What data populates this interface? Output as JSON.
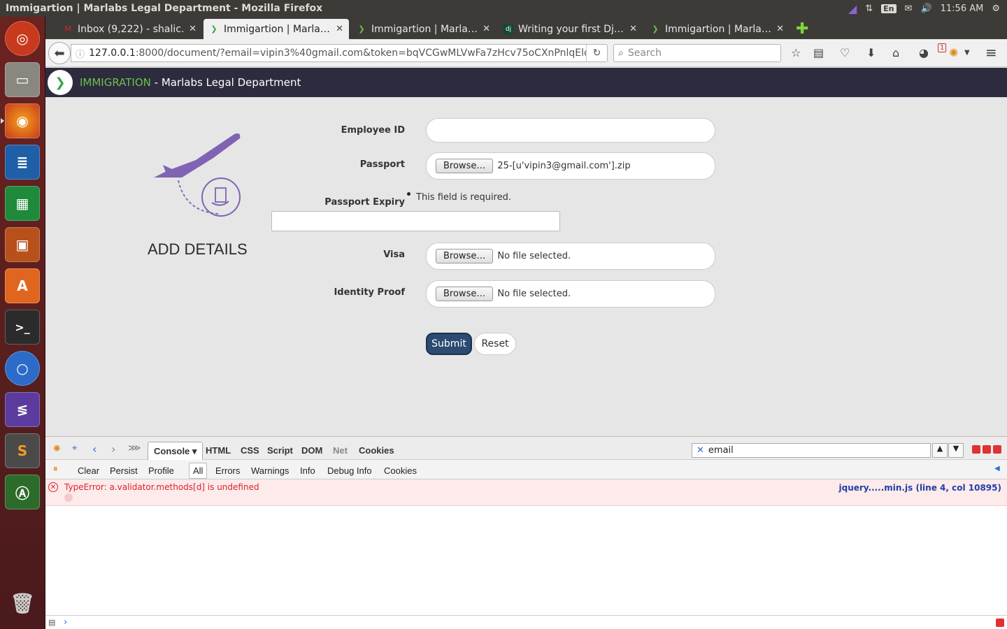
{
  "window": {
    "title": "Immigartion | Marlabs Legal Department - Mozilla Firefox",
    "clock": "11:56 AM",
    "keyboard": "En"
  },
  "tabs": [
    {
      "label": "Inbox (9,222) - shalic…",
      "icon": "gmail-icon"
    },
    {
      "label": "Immigartion | Marla…",
      "icon": "app-favicon-icon"
    },
    {
      "label": "Immigartion | Marla…",
      "icon": "app-favicon-icon"
    },
    {
      "label": "Writing your first Dj…",
      "icon": "django-icon"
    },
    {
      "label": "Immigartion | Marla…",
      "icon": "app-favicon-icon"
    }
  ],
  "nav": {
    "url_host": "127.0.0.1",
    "url_rest": ":8000/document/?email=vipin3%40gmail.com&token=bqVCGwMLVwFa7zHcv75oCXnPnlqElo:",
    "search_placeholder": "Search",
    "badge_count": "1"
  },
  "app": {
    "brand_app": "IMMIGRATION",
    "brand_org": " - Marlabs Legal Department"
  },
  "form": {
    "title": "ADD DETAILS",
    "employee_id_label": "Employee ID",
    "passport_label": "Passport",
    "passport_file": "25-[u'vipin3@gmail.com'].zip",
    "expiry_label": "Passport Expiry",
    "expiry_error": "This field is required.",
    "visa_label": "Visa",
    "visa_file": "No file selected.",
    "identity_label": "Identity Proof",
    "identity_file": "No file selected.",
    "browse_label": "Browse…",
    "submit_label": "Submit",
    "reset_label": "Reset"
  },
  "devtools": {
    "tabs": [
      "Console",
      "HTML",
      "CSS",
      "Script",
      "DOM",
      "Net",
      "Cookies"
    ],
    "search_value": "email",
    "filters": [
      "Clear",
      "Persist",
      "Profile",
      "All",
      "Errors",
      "Warnings",
      "Info",
      "Debug Info",
      "Cookies"
    ],
    "error_text": "TypeError: a.validator.methods[d] is undefined",
    "error_source": "jquery.....min.js (line 4, col 10895)"
  }
}
